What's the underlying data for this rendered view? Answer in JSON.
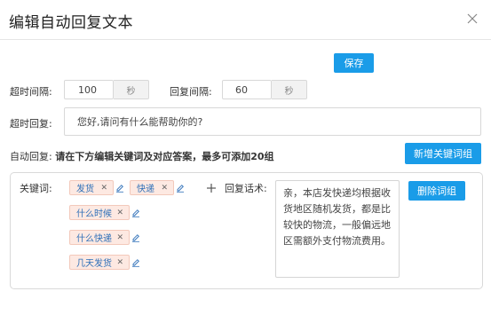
{
  "dialog": {
    "title": "编辑自动回复文本",
    "save_label": "保存"
  },
  "timeout": {
    "label": "超时间隔:",
    "value": "100",
    "unit": "秒"
  },
  "reply_interval": {
    "label": "回复间隔:",
    "value": "60",
    "unit": "秒"
  },
  "timeout_reply": {
    "label": "超时回复:",
    "value": "您好,请问有什么能帮助你的?"
  },
  "auto_reply": {
    "label": "自动回复:",
    "note": "请在下方编辑关键词及对应答案，最多可添加20组",
    "add_group_label": "新增关键词组"
  },
  "group": {
    "keywords_label": "关键词:",
    "keywords": [
      "发货",
      "快递",
      "什么时候",
      "什么快递",
      "几天发货"
    ],
    "answer_label": "回复话术:",
    "answer": "亲，本店发快递均根据收货地区随机发货，都是比较快的物流，一般偏远地区需额外支付物流费用。",
    "delete_label": "删除词组"
  },
  "icons": {
    "close": "close-icon",
    "edit": "pencil-icon",
    "add": "plus-icon",
    "remove": "x-icon"
  },
  "colors": {
    "accent": "#1a9ce8",
    "tag_background": "#fde9e2",
    "tag_text": "#2d6fb8"
  }
}
